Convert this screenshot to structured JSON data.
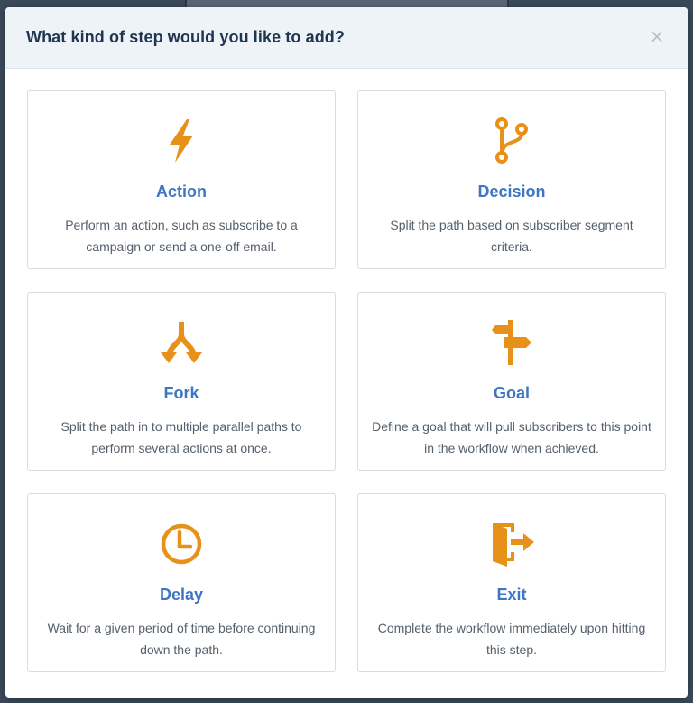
{
  "modal": {
    "title": "What kind of step would you like to add?",
    "close_label": "×"
  },
  "accent_color": "#e8911a",
  "title_color": "#3e76c4",
  "options": [
    {
      "title": "Action",
      "description": "Perform an action, such as subscribe to a campaign or send a one-off email.",
      "icon": "lightning-bolt-icon"
    },
    {
      "title": "Decision",
      "description": "Split the path based on subscriber segment criteria.",
      "icon": "branch-icon"
    },
    {
      "title": "Fork",
      "description": "Split the path in to multiple parallel paths to perform several actions at once.",
      "icon": "fork-icon"
    },
    {
      "title": "Goal",
      "description": "Define a goal that will pull subscribers to this point in the workflow when achieved.",
      "icon": "signpost-icon"
    },
    {
      "title": "Delay",
      "description": "Wait for a given period of time before continuing down the path.",
      "icon": "clock-icon"
    },
    {
      "title": "Exit",
      "description": "Complete the workflow immediately upon hitting this step.",
      "icon": "exit-door-icon"
    }
  ]
}
